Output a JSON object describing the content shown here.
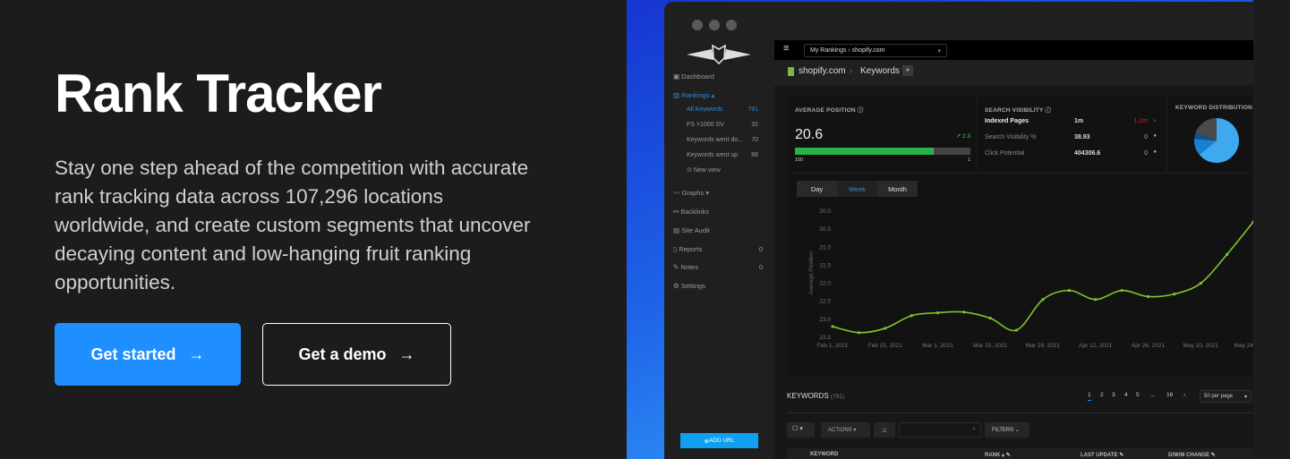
{
  "hero": {
    "title": "Rank Tracker",
    "description": "Stay one step ahead of the competition with accurate rank tracking data across 107,296 locations worldwide, and create custom segments that uncover decaying content and low-hanging fruit ranking opportunities.",
    "primary_button": "Get started",
    "secondary_button": "Get a demo",
    "accent": "#1f8fff"
  },
  "app": {
    "topbar": {
      "project_select": "My Rankings › shopify.com"
    },
    "breadcrumb": {
      "site": "shopify.com",
      "page": "Keywords"
    },
    "sidebar": {
      "dashboard": "Dashboard",
      "rankings": "Rankings",
      "views": [
        {
          "label": "All Keywords",
          "count": "791"
        },
        {
          "label": "FS >1000 SV",
          "count": "32"
        },
        {
          "label": "Keywords went do...",
          "count": "70"
        },
        {
          "label": "Keywords went up",
          "count": "88"
        }
      ],
      "new_view": "New view",
      "graphs": "Graphs",
      "backlinks": "Backlinks",
      "site_audit": "Site Audit",
      "reports": "Reports",
      "reports_count": "0",
      "notes": "Notes",
      "notes_count": "0",
      "settings": "Settings",
      "add_url": "ADD URL"
    },
    "avg_position": {
      "label": "AVERAGE POSITION",
      "value": "20.6",
      "change": "2.3",
      "bar_min": "100",
      "bar_max": "1",
      "fill_percent": 79
    },
    "search_visibility": {
      "label": "SEARCH VISIBILITY",
      "rows": [
        {
          "name": "Indexed Pages",
          "value": "1m",
          "change": "1.2m"
        },
        {
          "name": "Search Visibility %",
          "value": "38.93",
          "change": "0"
        },
        {
          "name": "Click Potential",
          "value": "404306.6",
          "change": "0"
        }
      ]
    },
    "keyword_distribution": {
      "label": "KEYWORD DISTRIBUTION",
      "slices": [
        {
          "value": 64,
          "color": "#3fa9f0"
        },
        {
          "value": 12,
          "color": "#1a80d0"
        },
        {
          "value": 5,
          "color": "#15508c"
        },
        {
          "value": 19,
          "color": "#4a4a4a"
        }
      ]
    },
    "range_tabs": [
      "Day",
      "Week",
      "Month"
    ],
    "active_tab": "Week",
    "keywords": {
      "title": "KEYWORDS",
      "count": "(791)",
      "pages": [
        "1",
        "2",
        "3",
        "4",
        "5",
        "...",
        "16",
        "›"
      ],
      "per_page": "50 per page",
      "actions": "ACTIONS",
      "filters": "FILTERS",
      "columns": [
        "KEYWORD",
        "RANK",
        "LAST UPDATE",
        "D/W/M CHANGE"
      ]
    }
  },
  "chart_data": {
    "type": "line",
    "ylabel": "Average Position",
    "y_inverted": true,
    "ylim": [
      20.0,
      23.5
    ],
    "yticks": [
      "20.0",
      "20.5",
      "21.0",
      "21.5",
      "22.0",
      "22.5",
      "23.0",
      "23.5"
    ],
    "xtick_labels": [
      "Feb 1, 2021",
      "Feb 15, 2021",
      "Mar 1, 2021",
      "Mar 15, 2021",
      "Mar 29, 2021",
      "Apr 12, 2021",
      "Apr 26, 2021",
      "May 10, 2021",
      "May 24"
    ],
    "x": [
      "2021-02-01",
      "2021-02-08",
      "2021-02-15",
      "2021-02-22",
      "2021-03-01",
      "2021-03-08",
      "2021-03-15",
      "2021-03-22",
      "2021-03-29",
      "2021-04-05",
      "2021-04-12",
      "2021-04-19",
      "2021-04-26",
      "2021-05-03",
      "2021-05-10",
      "2021-05-17",
      "2021-05-24"
    ],
    "values": [
      23.2,
      23.37,
      23.25,
      22.9,
      22.82,
      22.8,
      22.97,
      23.3,
      22.45,
      22.2,
      22.45,
      22.2,
      22.37,
      22.3,
      22.0,
      21.2,
      20.3
    ],
    "color": "#7dc62e",
    "grid": false
  }
}
